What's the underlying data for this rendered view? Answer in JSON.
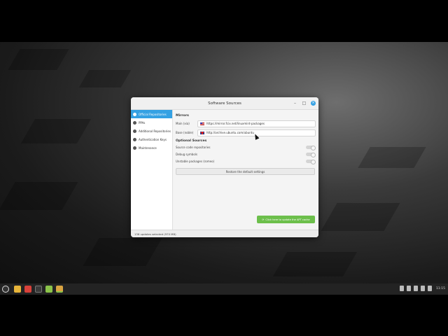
{
  "window": {
    "title": "Software Sources",
    "controls": {
      "minimize": "–",
      "maximize": "□",
      "close": "×"
    }
  },
  "sidebar": {
    "items": [
      {
        "label": "Official Repositories",
        "icon": "official-repos-icon",
        "active": true
      },
      {
        "label": "PPAs",
        "icon": "ppa-icon",
        "active": false
      },
      {
        "label": "Additional Repositories",
        "icon": "additional-repos-icon",
        "active": false
      },
      {
        "label": "Authentication Keys",
        "icon": "key-icon",
        "active": false
      },
      {
        "label": "Maintenance",
        "icon": "maintenance-icon",
        "active": false
      }
    ]
  },
  "mirrors": {
    "heading": "Mirrors",
    "main_label": "Main (xia)",
    "main_url": "https://mirror.fcix.net/linuxmint-packages",
    "base_label": "Base (noble)",
    "base_url": "http://archive.ubuntu.com/ubuntu"
  },
  "optional": {
    "heading": "Optional Sources",
    "items": [
      {
        "label": "Source code repositories",
        "enabled": false
      },
      {
        "label": "Debug symbols",
        "enabled": false
      },
      {
        "label": "Unstable packages (romeo)",
        "enabled": false
      }
    ]
  },
  "restore_label": "Restore the default settings",
  "update_label": "Click here to update the APT cache",
  "status_text": "136 updates selected (970 MB)",
  "taskbar": {
    "clock": "11:15",
    "apps": [
      "menu-icon",
      "files-icon",
      "software-manager-icon",
      "terminal-icon",
      "update-manager-icon",
      "software-sources-icon"
    ]
  },
  "colors": {
    "accent": "#35a1e3",
    "update_button": "#6cbf4b",
    "taskbar": "#232323"
  }
}
